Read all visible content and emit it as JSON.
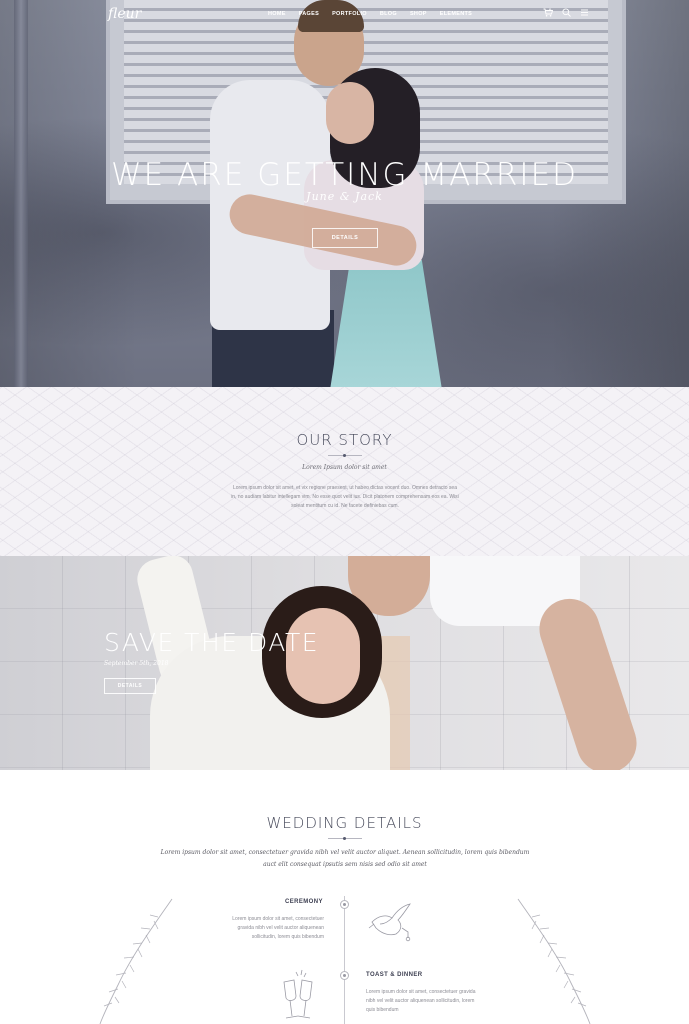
{
  "nav": {
    "logo": "fleur",
    "menu": [
      "HOME",
      "PAGES",
      "PORTFOLIO",
      "BLOG",
      "SHOP",
      "ELEMENTS"
    ],
    "icons": [
      "cart-icon",
      "search-icon",
      "menu-icon"
    ],
    "cart_count": "0"
  },
  "hero": {
    "title": "WE ARE GETTING MARRIED",
    "subtitle": "June & Jack",
    "button": "DETAILS"
  },
  "story": {
    "title": "OUR STORY",
    "subtitle": "Lorem Ipsum dolor sit amet",
    "body": "Lorem ipsum dolor sit amet, et vix regione praesent, ut habeo dictas vocent duo. Omnes detracto sea in, no audiam labitur intellegam vim. No esse quot velit ius. Dicit platonem comprehensam eos ea. Wisi soleat mentitum cu id. Ne facete definiebas cum."
  },
  "save": {
    "title": "SAVE THE DATE",
    "date": "September 5th, 2018",
    "button": "DETAILS"
  },
  "wedding_details": {
    "title": "WEDDING DETAILS",
    "subtitle": "Lorem ipsum dolor sit amet, consectetuer gravida nibh vel velit auctor aliquet. Aenean sollicitudin, lorem quis bibendum auct elit consequat ipsutis sem nisis sed odio sit amet",
    "events": [
      {
        "title": "CEREMONY",
        "body": "Lorem ipsum dolor sit amet, consectetuer gravida nibh vel velit auctor aliquenean sollicitudin, lorem quis bibendum",
        "icon": "dove-icon"
      },
      {
        "title": "TOAST & DINNER",
        "body": "Lorem ipsum dolor sit amet, consectetuer gravida nibh vel velit auctor aliquenean sollicitudin, lorem quis bibendum",
        "icon": "champagne-glasses-icon"
      }
    ]
  },
  "colors": {
    "accent": "#46495a",
    "story_bg": "#f4f2f6",
    "text_muted": "#8a8a92"
  }
}
